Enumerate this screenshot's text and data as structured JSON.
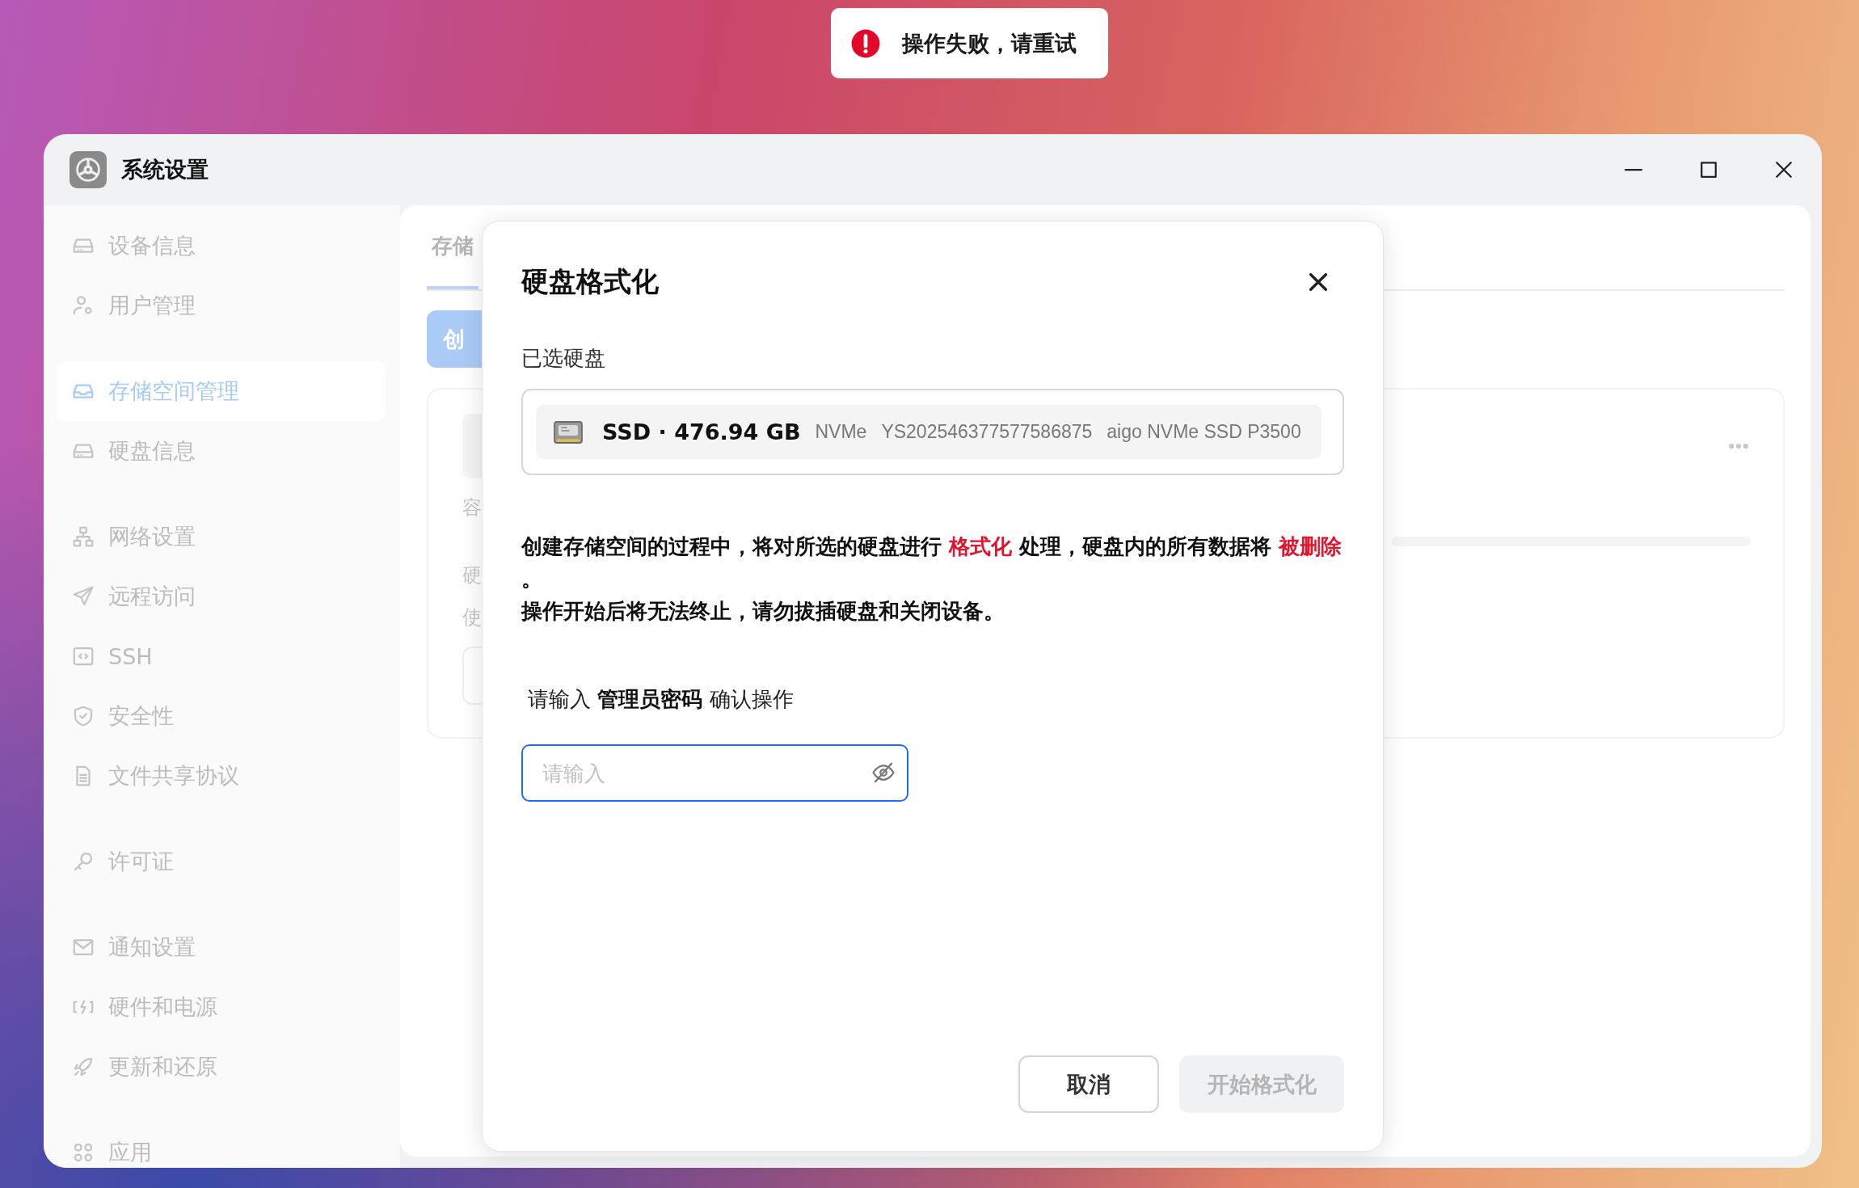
{
  "toast": {
    "kind": "error",
    "message": "操作失败，请重试"
  },
  "window": {
    "title": "系统设置"
  },
  "sidebar": {
    "groups": [
      {
        "items": [
          {
            "label": "设备信息",
            "selected": false
          },
          {
            "label": "用户管理",
            "selected": false
          }
        ]
      },
      {
        "items": [
          {
            "label": "存储空间管理",
            "selected": true
          },
          {
            "label": "硬盘信息",
            "selected": false
          }
        ]
      },
      {
        "items": [
          {
            "label": "网络设置",
            "selected": false
          },
          {
            "label": "远程访问",
            "selected": false
          },
          {
            "label": "SSH",
            "selected": false
          },
          {
            "label": "安全性",
            "selected": false
          },
          {
            "label": "文件共享协议",
            "selected": false
          }
        ]
      },
      {
        "items": [
          {
            "label": "许可证",
            "selected": false
          }
        ]
      },
      {
        "items": [
          {
            "label": "通知设置",
            "selected": false
          },
          {
            "label": "硬件和电源",
            "selected": false
          },
          {
            "label": "更新和还原",
            "selected": false
          }
        ]
      },
      {
        "items": [
          {
            "label": "应用",
            "selected": false
          }
        ]
      }
    ]
  },
  "main": {
    "tabs": [
      {
        "label": "存储",
        "selected": true
      }
    ],
    "create_button": "创",
    "card": {
      "labels": [
        "容",
        "硬",
        "使"
      ]
    }
  },
  "dialog": {
    "title": "硬盘格式化",
    "selected_label": "已选硬盘",
    "disk": {
      "name": "SSD · 476.94 GB",
      "details": [
        "NVMe",
        "YS202546377577586875",
        "aigo NVMe SSD P3500"
      ]
    },
    "warning": [
      [
        {
          "kind": "normal",
          "text": "创建存储空间的过程中，将对所选的硬盘进行 "
        },
        {
          "kind": "danger",
          "text": "格式化"
        },
        {
          "kind": "normal",
          "text": " 处理，硬盘内的所有数据将 "
        },
        {
          "kind": "danger",
          "text": "被删除"
        },
        {
          "kind": "normal",
          "text": " 。"
        }
      ],
      [
        {
          "kind": "normal",
          "text": "操作开始后将无法终止，请勿拔插硬盘和关闭设备。"
        }
      ]
    ],
    "prompt": "请输入 **管理员密码** 确认操作",
    "password": {
      "placeholder": "请输入",
      "focused": true
    },
    "buttons": [
      {
        "label": "取消",
        "disabled": false
      },
      {
        "label": "开始格式化",
        "disabled": true
      }
    ]
  }
}
